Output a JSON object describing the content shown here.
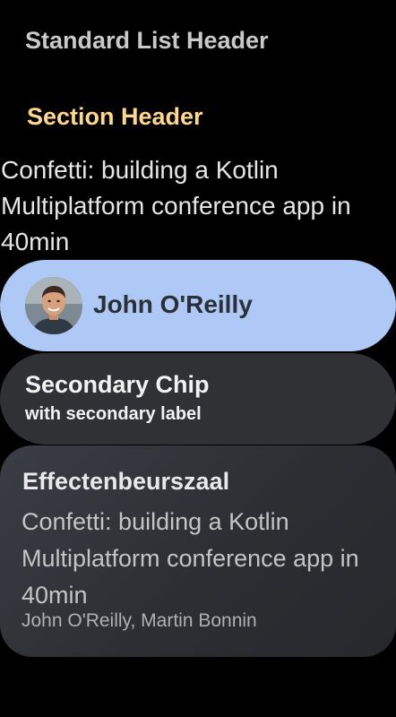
{
  "list_header": "Standard List Header",
  "section_header": "Section Header",
  "body_text": "Confetti: building a Kotlin Multiplatform conference app in 40min",
  "primary_chip": {
    "label": "John O'Reilly",
    "avatar": "avatar-photo",
    "color": "#aec9f6"
  },
  "secondary_chip": {
    "title": "Secondary Chip",
    "subtitle": "with secondary label",
    "color": "#303135"
  },
  "card": {
    "title": "Effectenbeurszaal",
    "body": "Confetti: building a Kotlin Multiplatform conference app in 40min",
    "footer": "John O'Reilly, Martin Bonnin"
  },
  "colors": {
    "section_header": "#ffd985",
    "background": "#000000"
  }
}
